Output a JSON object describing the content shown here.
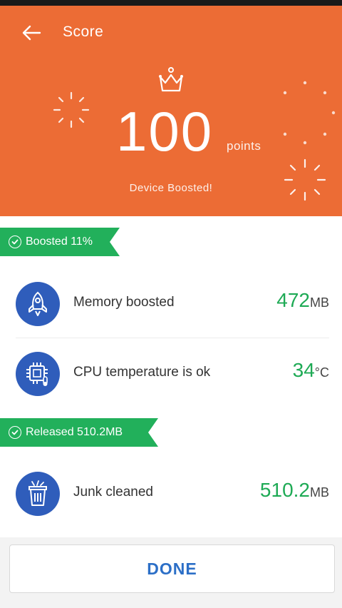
{
  "header": {
    "title": "Score",
    "back_icon": "arrow-left-icon",
    "score": "100",
    "score_unit": "points",
    "subtitle": "Device Boosted!",
    "bg_color": "#ec6c35"
  },
  "sections": [
    {
      "badge": "Boosted 11%",
      "items": [
        {
          "label": "Memory boosted",
          "value": "472",
          "unit": "MB",
          "icon": "rocket-icon"
        },
        {
          "label": "CPU temperature is ok",
          "value": "34",
          "unit": "°C",
          "icon": "cpu-thermometer-icon"
        }
      ]
    },
    {
      "badge": "Released 510.2MB",
      "items": [
        {
          "label": "Junk cleaned",
          "value": "510.2",
          "unit": "MB",
          "icon": "trash-icon"
        }
      ]
    }
  ],
  "footer": {
    "done_label": "DONE"
  },
  "colors": {
    "accent_green": "#22b05b",
    "icon_blue": "#2f5dbb",
    "button_text": "#2c6fc7"
  }
}
